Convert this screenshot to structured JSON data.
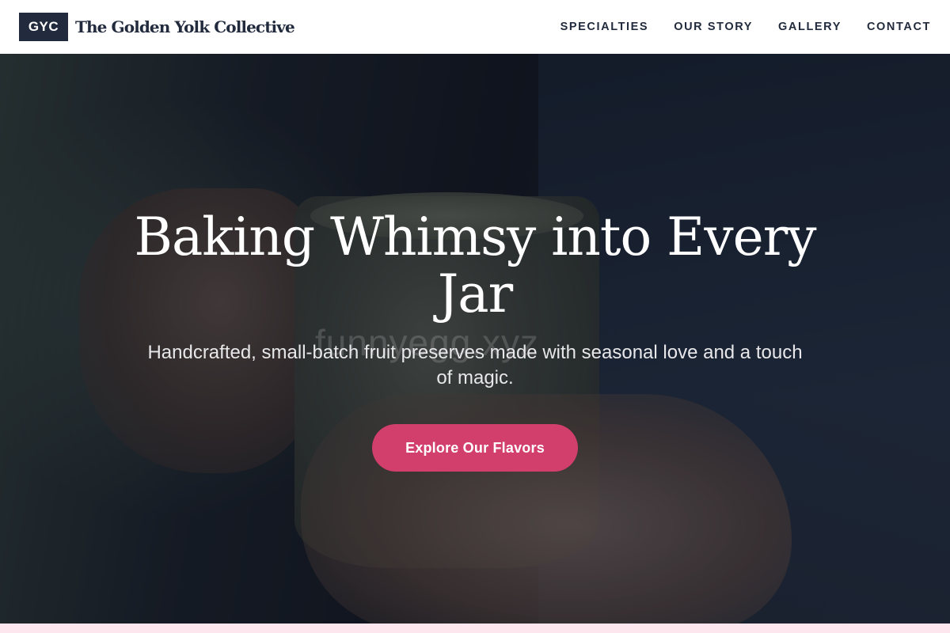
{
  "header": {
    "logo_badge": "GYC",
    "logo_name": "The Golden Yolk Collective",
    "nav": [
      {
        "label": "SPECIALTIES"
      },
      {
        "label": "OUR STORY"
      },
      {
        "label": "GALLERY"
      },
      {
        "label": "CONTACT"
      }
    ]
  },
  "hero": {
    "title": "Baking Whimsy into Every Jar",
    "subtitle": "Handcrafted, small-batch fruit preserves made with seasonal love and a touch of magic.",
    "cta_label": "Explore Our Flavors",
    "watermark": "funnyegg.xyz"
  },
  "colors": {
    "navy": "#222b3d",
    "accent_pink": "#d23f6c",
    "strip_pink": "#fde6ee"
  }
}
